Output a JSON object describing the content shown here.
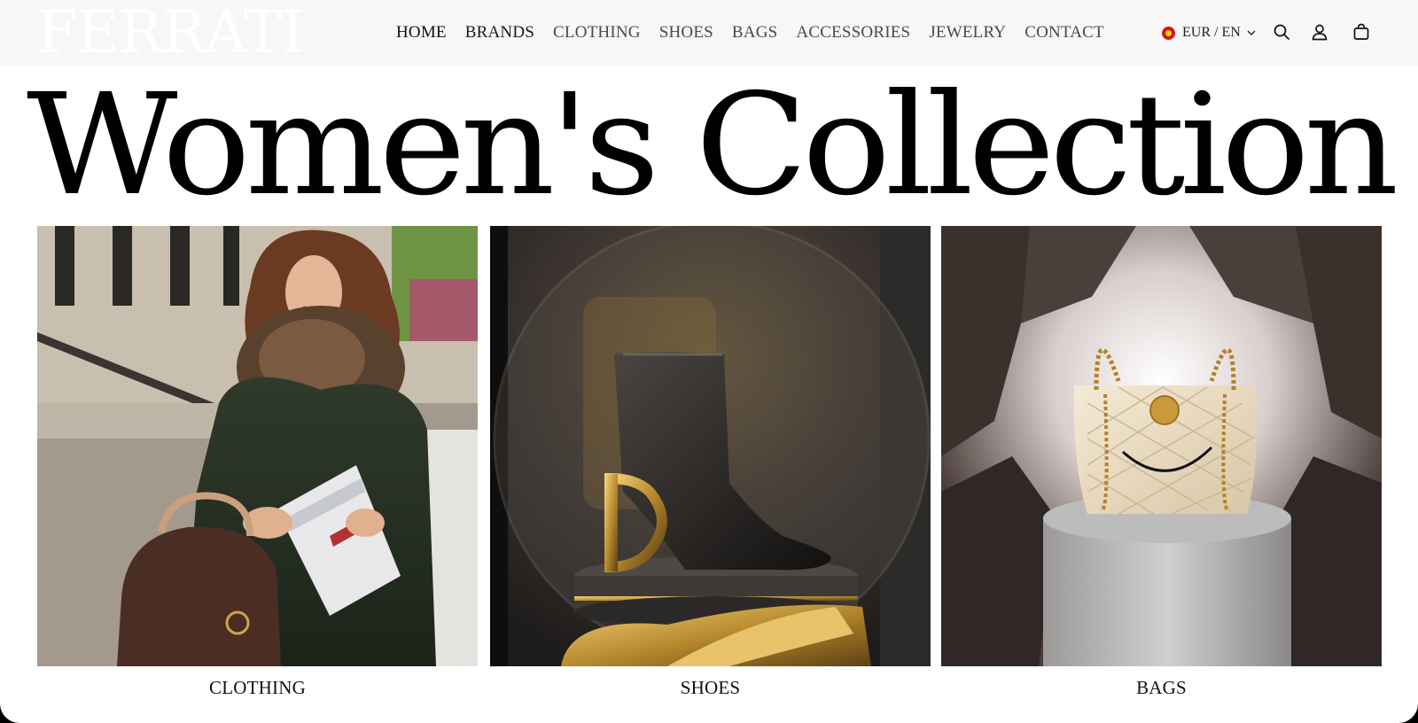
{
  "header": {
    "logo": "FERRATI",
    "nav": [
      {
        "label": "HOME"
      },
      {
        "label": "BRANDS"
      },
      {
        "label": "CLOTHING"
      },
      {
        "label": "SHOES"
      },
      {
        "label": "BAGS"
      },
      {
        "label": "ACCESSORIES"
      },
      {
        "label": "JEWELRY"
      },
      {
        "label": "CONTACT"
      }
    ],
    "locale": {
      "label": "EUR / EN",
      "flag_icon": "north-macedonia-flag-icon"
    },
    "icons": [
      "search-icon",
      "account-icon",
      "cart-icon"
    ]
  },
  "hero": {
    "title": "Women's Collection"
  },
  "categories": [
    {
      "label": "CLOTHING",
      "image": "woman-in-green-coat-with-fur-collar-holding-handbag-and-newspaper"
    },
    {
      "label": "SHOES",
      "image": "black-ankle-boot-with-gold-D-heel-on-pedestal"
    },
    {
      "label": "BAGS",
      "image": "cream-quilted-handbag-with-gold-chain-on-stone-pedestal"
    }
  ],
  "colors": {
    "background": "#ffffff",
    "topbar": "#f7f7f7",
    "text": "#111111",
    "nav_text": "#4a4a4a"
  }
}
